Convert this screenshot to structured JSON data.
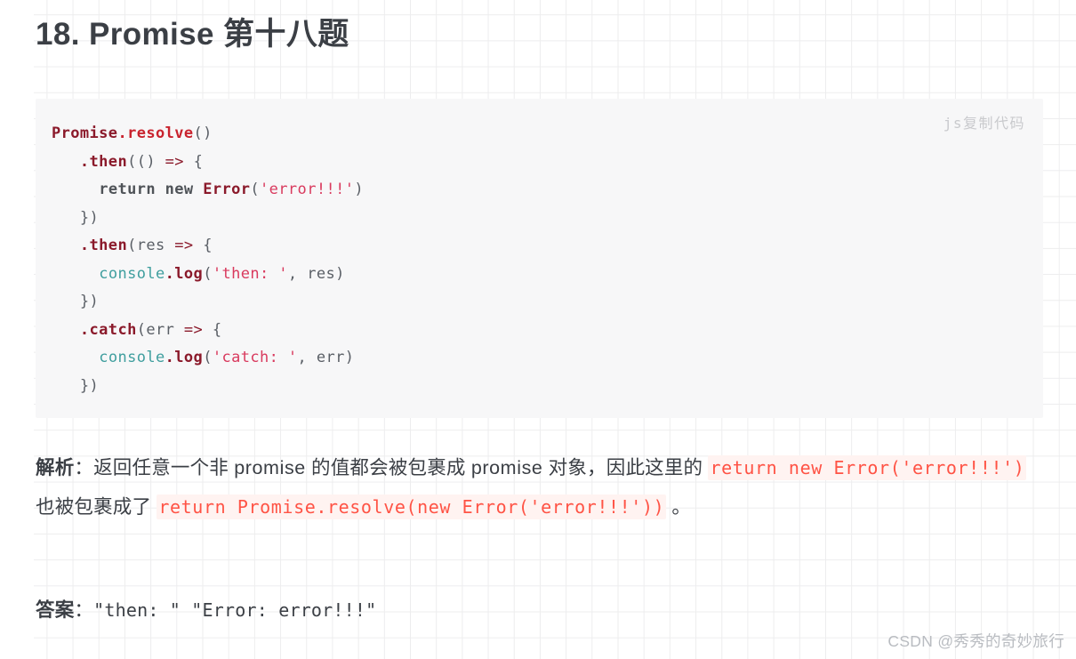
{
  "page": {
    "title": "18. Promise 第十八题",
    "watermark": "CSDN @秀秀的奇妙旅行",
    "grid_line_color": "#ededee",
    "text_color": "#3b3f45"
  },
  "code_block": {
    "lang_copy_label": "js复制代码",
    "background": "#f7f7f8",
    "language": "js",
    "lines": [
      "Promise.resolve()",
      "   .then(() => {",
      "     return new Error('error!!!')",
      "   })",
      "   .then(res => {",
      "     console.log('then: ', res)",
      "   })",
      "   .catch(err => {",
      "     console.log('catch: ', err)",
      "   })"
    ],
    "tokens": {
      "class_color": "#8b1a2b",
      "method_color": "#c9242f",
      "object_color": "#3f9e9e",
      "string_color": "#d93a5e",
      "punctuation_color": "#5a5f66"
    }
  },
  "analysis": {
    "label": "解析",
    "colon": "：",
    "t1": "返回任意一个非 ",
    "t2": "promise",
    "t3": " 的值都会被包裹成 ",
    "t4": "promise",
    "t5": " 对象，因此这里的 ",
    "code1": "return new Error('error!!!')",
    "t6": " 也被包裹成了 ",
    "code2": "return Promise.resolve(new Error('error!!!'))",
    "t7": " 。",
    "inline_code_color": "#ff5345",
    "inline_code_bg": "#fff3f1"
  },
  "answer": {
    "label": "答案",
    "colon": "：",
    "value": "\"then: \" \"Error: error!!!\""
  }
}
